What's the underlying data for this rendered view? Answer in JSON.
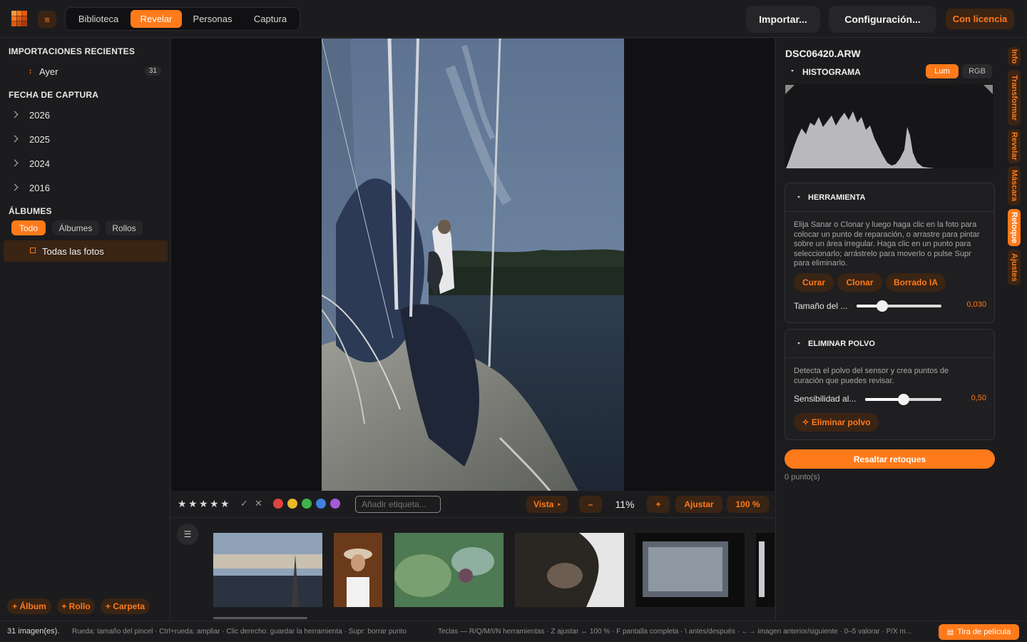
{
  "nav": {
    "tabs": [
      "Biblioteca",
      "Revelar",
      "Personas",
      "Captura"
    ],
    "active": "Revelar"
  },
  "top": {
    "import_label": "Importar...",
    "config_label": "Configuración...",
    "license_label": "Con licencia"
  },
  "sidebar": {
    "recent_title": "IMPORTACIONES RECIENTES",
    "recent_item": {
      "label": "Ayer",
      "count": "31"
    },
    "date_title": "FECHA DE CAPTURA",
    "years": [
      "2026",
      "2025",
      "2024",
      "2016"
    ],
    "albums_title": "ÁLBUMES",
    "album_filters": [
      "Todo",
      "Álbumes",
      "Rollos"
    ],
    "all_photos": "Todas las fotos",
    "bottom_buttons": [
      "+ Álbum",
      "+ Rollo",
      "+ Carpeta"
    ]
  },
  "controls": {
    "rating_stars": 5,
    "tag_placeholder": "Añadir etiqueta...",
    "view_label": "Vista",
    "minus_label": "–",
    "zoom": "11%",
    "plus_label": "+",
    "fit_label": "Ajustar",
    "full_label": "100 %",
    "colors": [
      "#e0443c",
      "#e9b92c",
      "#3fb24a",
      "#3e7fe0",
      "#a45ad6"
    ]
  },
  "panel": {
    "filename": "DSC06420.ARW",
    "histogram_title": "HISTOGRAMA",
    "hist_modes": [
      "Lum",
      "RGB"
    ],
    "tool_title": "HERRAMIENTA",
    "tool_help": "Elija Sanar o Clonar y luego haga clic en la foto para colocar un punto de reparación, o arrastre para pintar sobre un área irregular. Haga clic en un punto para seleccionarlo; arrástrelo para moverlo o pulse Supr para eliminarlo.",
    "tool_buttons": [
      "Curar",
      "Clonar",
      "Borrado IA"
    ],
    "size_label": "Tamaño del ...",
    "size_value": "0,030",
    "size_level": 0.3,
    "dust_title": "ELIMINAR POLVO",
    "dust_help": "Detecta el polvo del sensor y crea puntos de curación que puedes revisar.",
    "sens_label": "Sensibilidad al...",
    "sens_value": "0,50",
    "sens_level": 0.5,
    "remove_dust_label": "✧ Eliminar polvo",
    "highlight_label": "Resaltar retoques",
    "points": "0 punto(s)",
    "side_tabs": [
      "Info",
      "Transformar",
      "Revelar",
      "Máscara",
      "Retoque",
      "Ajustes"
    ],
    "active_side_tab": "Retoque"
  },
  "status": {
    "count": "31 imagen(es).",
    "hint1": "Rueda: tamaño del pincel · Ctrl+rueda: ampliar · Clic derecho: guardar la herramienta · Supr: borrar punto",
    "hint2": "Teclas — R/Q/M/I/N herramientas · Z ajustar ↔ 100 % · F pantalla completa · \\ antes/después · ←→ imagen anterior/siguiente · 0–5 valorar · P/X m...",
    "filmstrip_label": "Tira de película"
  },
  "colors": {
    "accent": "#ff7a1a",
    "accent_dark": "#3a2414",
    "bg": "#1c1c1e",
    "canvas": "#111113"
  }
}
